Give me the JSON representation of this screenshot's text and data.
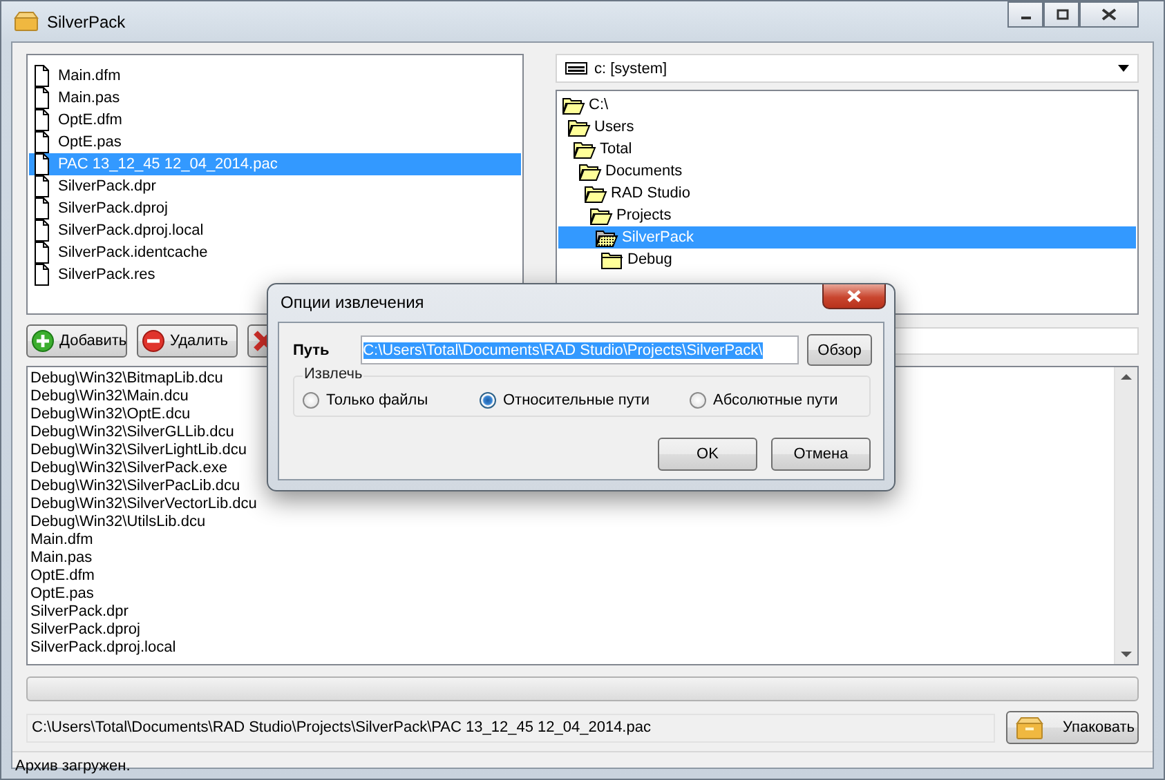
{
  "window": {
    "title": "SilverPack"
  },
  "files": [
    {
      "name": "Main.dfm",
      "selected": false
    },
    {
      "name": "Main.pas",
      "selected": false
    },
    {
      "name": "OptE.dfm",
      "selected": false
    },
    {
      "name": "OptE.pas",
      "selected": false
    },
    {
      "name": "PAC 13_12_45 12_04_2014.pac",
      "selected": true
    },
    {
      "name": "SilverPack.dpr",
      "selected": false
    },
    {
      "name": "SilverPack.dproj",
      "selected": false
    },
    {
      "name": "SilverPack.dproj.local",
      "selected": false
    },
    {
      "name": "SilverPack.identcache",
      "selected": false
    },
    {
      "name": "SilverPack.res",
      "selected": false
    }
  ],
  "drive": "c: [system]",
  "tree": {
    "label": "C:\\",
    "expanded": true,
    "selected": false,
    "children": [
      {
        "label": "Users",
        "expanded": true,
        "selected": false,
        "children": [
          {
            "label": "Total",
            "expanded": true,
            "selected": false,
            "children": [
              {
                "label": "Documents",
                "expanded": true,
                "selected": false,
                "children": [
                  {
                    "label": "RAD Studio",
                    "expanded": true,
                    "selected": false,
                    "children": [
                      {
                        "label": "Projects",
                        "expanded": true,
                        "selected": false,
                        "children": [
                          {
                            "label": "SilverPack",
                            "expanded": true,
                            "selected": true,
                            "children": [
                              {
                                "label": "Debug",
                                "expanded": false,
                                "selected": false
                              }
                            ]
                          }
                        ]
                      }
                    ]
                  }
                ]
              }
            ]
          }
        ]
      }
    ]
  },
  "buttons": [
    {
      "kind": "add",
      "label": "Добавить"
    },
    {
      "kind": "remove",
      "label": "Удалить"
    },
    {
      "kind": "clear"
    }
  ],
  "archive_entries": [
    "Debug\\Win32\\BitmapLib.dcu",
    "Debug\\Win32\\Main.dcu",
    "Debug\\Win32\\OptE.dcu",
    "Debug\\Win32\\SilverGLLib.dcu",
    "Debug\\Win32\\SilverLightLib.dcu",
    "Debug\\Win32\\SilverPack.exe",
    "Debug\\Win32\\SilverPacLib.dcu",
    "Debug\\Win32\\SilverVectorLib.dcu",
    "Debug\\Win32\\UtilsLib.dcu",
    "Main.dfm",
    "Main.pas",
    "OptE.dfm",
    "OptE.pas",
    "SilverPack.dpr",
    "SilverPack.dproj",
    "SilverPack.dproj.local"
  ],
  "progress": {
    "level": 0
  },
  "archive_path": "C:\\Users\\Total\\Documents\\RAD Studio\\Projects\\SilverPack\\PAC 13_12_45 12_04_2014.pac",
  "pack_button": "Упаковать",
  "status_bar": "Архив загружен.",
  "dialog": {
    "title": "Опции извлечения",
    "path_label": "Путь",
    "path_value": "C:\\Users\\Total\\Documents\\RAD Studio\\Projects\\SilverPack\\",
    "path_selected": true,
    "browse_button": "Обзор",
    "extract": {
      "title": "Извлечь",
      "options": [
        {
          "label": "Только файлы",
          "selected": false
        },
        {
          "label": "Относительные пути",
          "selected": true
        },
        {
          "label": "Абсолютные пути",
          "selected": false
        }
      ]
    },
    "buttons": [
      "OK",
      "Отмена"
    ]
  }
}
